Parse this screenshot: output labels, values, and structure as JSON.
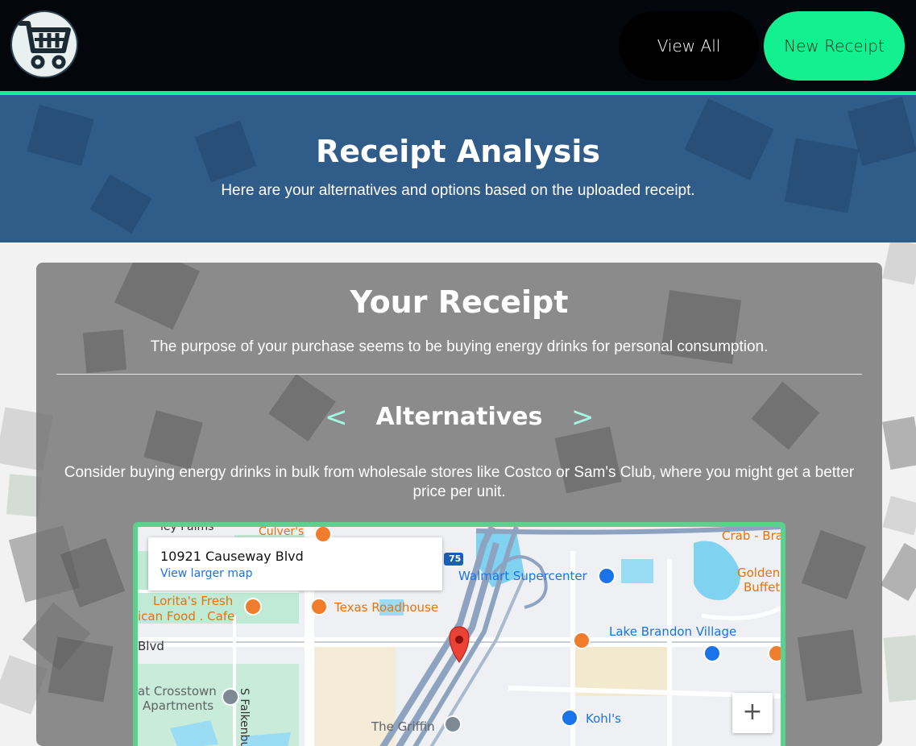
{
  "nav": {
    "view_all_label": "View All",
    "new_receipt_label": "New Receipt"
  },
  "hero": {
    "title": "Receipt Analysis",
    "subtitle": "Here are your alternatives and options based on the uploaded receipt."
  },
  "receipt": {
    "title": "Your Receipt",
    "purpose": "The purpose of your purchase seems to be buying energy drinks for personal consumption.",
    "alternatives": {
      "title": "Alternatives",
      "prev_label": "<",
      "next_label": ">",
      "text": "Consider buying energy drinks in bulk from wholesale stores like Costco or Sam's Club, where you might get a better price per unit."
    }
  },
  "map": {
    "address": "10921 Causeway Blvd",
    "larger_map_link": "View larger map",
    "zoom_in_label": "+",
    "highway": "75",
    "labels": {
      "texas_roadhouse": "Texas Roadhouse",
      "walmart": "Walmart Supercenter",
      "lake_brandon": "Lake Brandon Village",
      "kohls": "Kohl's",
      "lorita_1": "Lorita's Fresh",
      "lorita_2": "ican Food . Cafe",
      "crosstown_1": "at Crosstown",
      "crosstown_2": "Apartments",
      "griffin": "The Griffin",
      "crab": "Crab - Bra",
      "golden_1": "Golden",
      "golden_2": "Buffet",
      "blvd": "Blvd",
      "falkenburg": "S Falkenburg Rd",
      "palms": "ley Palms",
      "culvers": "Culver's"
    }
  },
  "colors": {
    "accent": "#13f08f",
    "hero": "#2f5c88",
    "arrow": "#a6f5e0",
    "map_border": "#5bd18e"
  }
}
